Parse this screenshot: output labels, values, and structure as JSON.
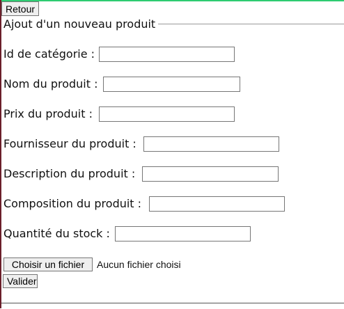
{
  "header": {
    "back_label": "Retour"
  },
  "form": {
    "legend": "Ajout d'un nouveau produit",
    "fields": [
      {
        "label": "Id de catégorie :",
        "value": ""
      },
      {
        "label": "Nom du produit :",
        "value": ""
      },
      {
        "label": "Prix du produit :",
        "value": ""
      },
      {
        "label": "Fournisseur du produit :",
        "value": ""
      },
      {
        "label": "Description du produit :",
        "value": ""
      },
      {
        "label": "Composition du produit :",
        "value": ""
      },
      {
        "label": "Quantité du stock :",
        "value": ""
      }
    ],
    "file": {
      "button_label": "Choisir un fichier",
      "status": "Aucun fichier choisi"
    },
    "submit_label": "Valider"
  },
  "colors": {
    "top_accent": "#2ecc71",
    "left_accent": "#6b1f2a"
  }
}
